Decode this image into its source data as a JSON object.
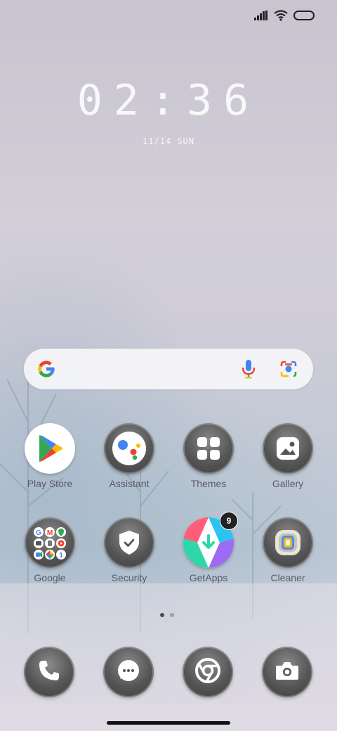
{
  "lock": {
    "time": "02:36",
    "date": "11/14 SUN"
  },
  "apps_row1": [
    {
      "label": "Play Store",
      "icon": "play-store-icon"
    },
    {
      "label": "Assistant",
      "icon": "assistant-icon"
    },
    {
      "label": "Themes",
      "icon": "themes-icon"
    },
    {
      "label": "Gallery",
      "icon": "gallery-icon"
    }
  ],
  "apps_row2": [
    {
      "label": "Google",
      "icon": "google-folder-icon"
    },
    {
      "label": "Security",
      "icon": "security-icon"
    },
    {
      "label": "GetApps",
      "icon": "getapps-icon",
      "badge": "9"
    },
    {
      "label": "Cleaner",
      "icon": "cleaner-icon"
    }
  ],
  "dock": [
    {
      "icon": "phone-icon"
    },
    {
      "icon": "messages-icon"
    },
    {
      "icon": "chrome-icon"
    },
    {
      "icon": "camera-icon"
    }
  ],
  "pager": {
    "count": 2,
    "active": 0
  },
  "colors": {
    "google_blue": "#4285F4",
    "google_red": "#EA4335",
    "google_yellow": "#FBBC05",
    "google_green": "#34A853"
  }
}
